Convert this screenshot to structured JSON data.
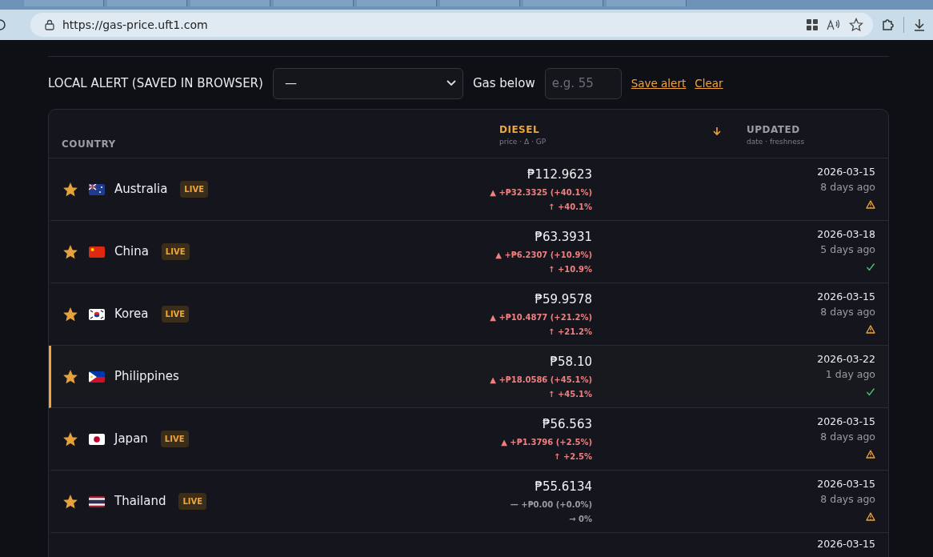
{
  "browser": {
    "url": "https://gas-price.uft1.com"
  },
  "alert": {
    "label": "LOCAL ALERT (SAVED IN BROWSER)",
    "select_value": "—",
    "threshold_label": "Gas below",
    "threshold_placeholder": "e.g. 55",
    "save": "Save alert",
    "clear": "Clear"
  },
  "table": {
    "columns": [
      {
        "title": "COUNTRY",
        "highlighted": false
      },
      {
        "title": "DIESEL",
        "subtitle": "price · Δ · GP",
        "highlighted": true
      },
      {
        "title": "UPDATED",
        "subtitle": "date · freshness",
        "highlighted": false
      }
    ],
    "rows": [
      {
        "country": "Australia",
        "starred": true,
        "live": true,
        "badge": "LIVE",
        "selected": false,
        "price": "₱112.9623",
        "delta": "▲ +₱32.3325 (+40.1%)",
        "rising": true,
        "change": "↑ +40.1%",
        "date": "2026-03-15",
        "age": "8 days ago",
        "stale": true
      },
      {
        "country": "China",
        "starred": true,
        "live": true,
        "badge": "LIVE",
        "selected": false,
        "price": "₱63.3931",
        "delta": "▲ +₱6.2307 (+10.9%)",
        "rising": true,
        "change": "↑ +10.9%",
        "date": "2026-03-18",
        "age": "5 days ago",
        "stale": false
      },
      {
        "country": "Korea",
        "starred": true,
        "live": true,
        "badge": "LIVE",
        "selected": false,
        "price": "₱59.9578",
        "delta": "▲ +₱10.4877 (+21.2%)",
        "rising": true,
        "change": "↑ +21.2%",
        "date": "2026-03-15",
        "age": "8 days ago",
        "stale": true
      },
      {
        "country": "Philippines",
        "starred": true,
        "live": false,
        "selected": true,
        "price": "₱58.10",
        "delta": "▲ +₱18.0586 (+45.1%)",
        "rising": true,
        "change": "↑ +45.1%",
        "date": "2026-03-22",
        "age": "1 day ago",
        "stale": false
      },
      {
        "country": "Japan",
        "starred": true,
        "live": true,
        "badge": "LIVE",
        "selected": false,
        "price": "₱56.563",
        "delta": "▲ +₱1.3796 (+2.5%)",
        "rising": true,
        "change": "↑ +2.5%",
        "date": "2026-03-15",
        "age": "8 days ago",
        "stale": true
      },
      {
        "country": "Thailand",
        "starred": true,
        "live": true,
        "badge": "LIVE",
        "selected": false,
        "price": "₱55.6134",
        "delta": "— +₱0.00 (+0.0%)",
        "rising": false,
        "change": "→ 0%",
        "date": "2026-03-15",
        "age": "8 days ago",
        "stale": true
      }
    ],
    "partial_row": {
      "date": "2026-03-15"
    }
  }
}
